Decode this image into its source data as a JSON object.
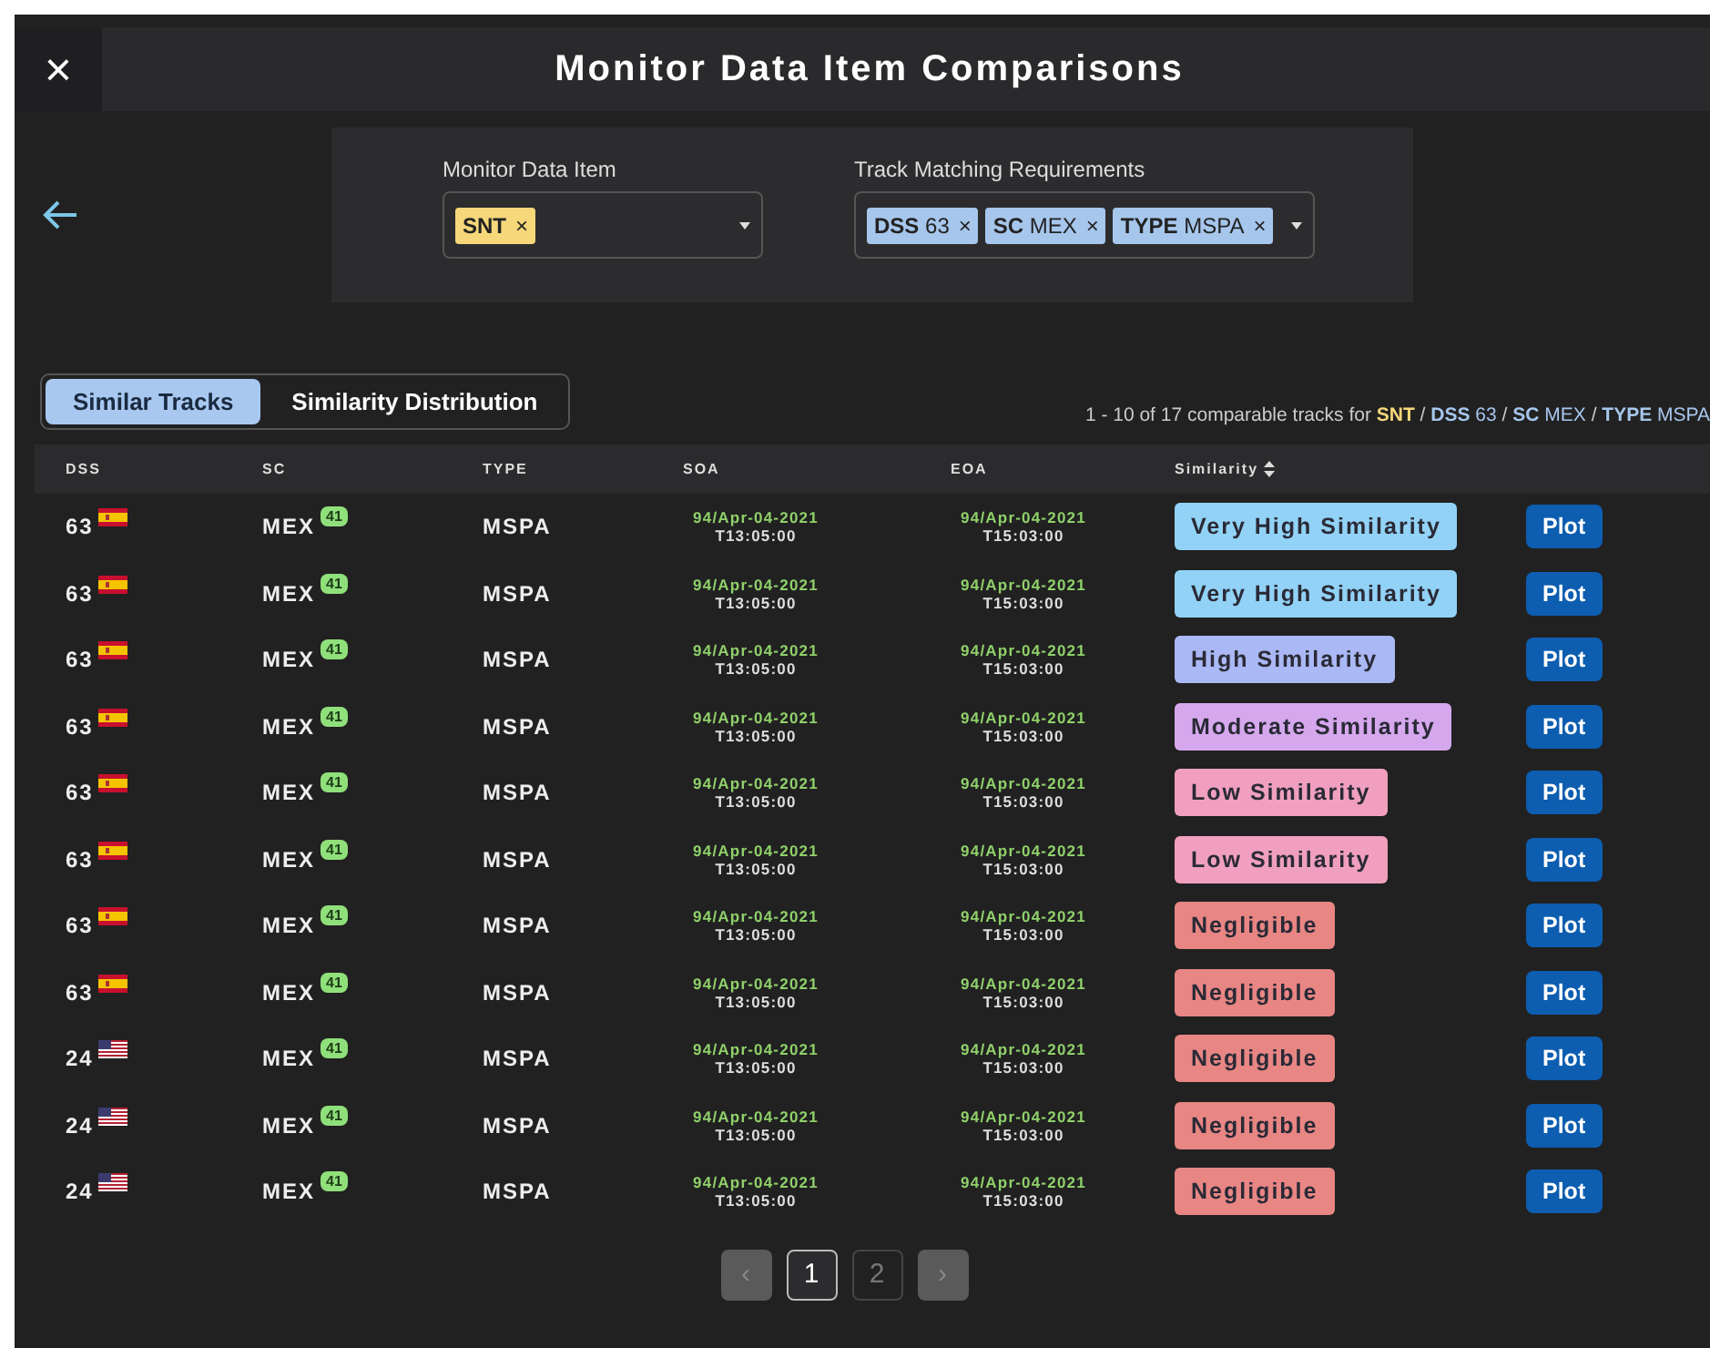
{
  "header": {
    "close": "×",
    "title": "Monitor Data Item Comparisons"
  },
  "filters": [
    {
      "label": "Monitor Data Item",
      "kind": "item",
      "chips": [
        {
          "key": "SNT",
          "remove": "×"
        }
      ]
    },
    {
      "label": "Track Matching Requirements",
      "kind": "requirement",
      "chips": [
        {
          "key": "DSS",
          "value": "63",
          "remove": "×"
        },
        {
          "key": "SC",
          "value": "MEX",
          "remove": "×"
        },
        {
          "key": "TYPE",
          "value": "MSPA",
          "remove": "×"
        }
      ]
    }
  ],
  "tabs": [
    {
      "label": "Similar Tracks",
      "selected": true
    },
    {
      "label": "Similarity Distribution",
      "selected": false
    }
  ],
  "summary": {
    "text": "1 - 10 of 17 comparable tracks for",
    "item": "SNT",
    "requirements": [
      {
        "key": "DSS",
        "value": "63"
      },
      {
        "key": "SC",
        "value": "MEX"
      },
      {
        "key": "TYPE",
        "value": "MSPA"
      }
    ],
    "separator": "/"
  },
  "table": {
    "columns": [
      "DSS",
      "SC",
      "TYPE",
      "SOA",
      "EOA",
      "Similarity"
    ],
    "rows": [
      {
        "dss": "63",
        "flag": {
          "kind": "es"
        },
        "sc": "MEX",
        "sc_badge": "41",
        "type": "MSPA",
        "soa": [
          "94/Apr-04-2021",
          "T13:05:00"
        ],
        "eoa": [
          "94/Apr-04-2021",
          "T15:03:00"
        ],
        "similarity": {
          "label": "Very High Similarity",
          "kind": "very_high"
        },
        "action": "Plot"
      },
      {
        "dss": "63",
        "flag": {
          "kind": "es"
        },
        "sc": "MEX",
        "sc_badge": "41",
        "type": "MSPA",
        "soa": [
          "94/Apr-04-2021",
          "T13:05:00"
        ],
        "eoa": [
          "94/Apr-04-2021",
          "T15:03:00"
        ],
        "similarity": {
          "label": "Very High Similarity",
          "kind": "very_high"
        },
        "action": "Plot"
      },
      {
        "dss": "63",
        "flag": {
          "kind": "es"
        },
        "sc": "MEX",
        "sc_badge": "41",
        "type": "MSPA",
        "soa": [
          "94/Apr-04-2021",
          "T13:05:00"
        ],
        "eoa": [
          "94/Apr-04-2021",
          "T15:03:00"
        ],
        "similarity": {
          "label": "High Similarity",
          "kind": "high"
        },
        "action": "Plot"
      },
      {
        "dss": "63",
        "flag": {
          "kind": "es"
        },
        "sc": "MEX",
        "sc_badge": "41",
        "type": "MSPA",
        "soa": [
          "94/Apr-04-2021",
          "T13:05:00"
        ],
        "eoa": [
          "94/Apr-04-2021",
          "T15:03:00"
        ],
        "similarity": {
          "label": "Moderate Similarity",
          "kind": "moderate"
        },
        "action": "Plot"
      },
      {
        "dss": "63",
        "flag": {
          "kind": "es"
        },
        "sc": "MEX",
        "sc_badge": "41",
        "type": "MSPA",
        "soa": [
          "94/Apr-04-2021",
          "T13:05:00"
        ],
        "eoa": [
          "94/Apr-04-2021",
          "T15:03:00"
        ],
        "similarity": {
          "label": "Low Similarity",
          "kind": "low"
        },
        "action": "Plot"
      },
      {
        "dss": "63",
        "flag": {
          "kind": "es"
        },
        "sc": "MEX",
        "sc_badge": "41",
        "type": "MSPA",
        "soa": [
          "94/Apr-04-2021",
          "T13:05:00"
        ],
        "eoa": [
          "94/Apr-04-2021",
          "T15:03:00"
        ],
        "similarity": {
          "label": "Low Similarity",
          "kind": "low"
        },
        "action": "Plot"
      },
      {
        "dss": "63",
        "flag": {
          "kind": "es"
        },
        "sc": "MEX",
        "sc_badge": "41",
        "type": "MSPA",
        "soa": [
          "94/Apr-04-2021",
          "T13:05:00"
        ],
        "eoa": [
          "94/Apr-04-2021",
          "T15:03:00"
        ],
        "similarity": {
          "label": "Negligible",
          "kind": "negligible"
        },
        "action": "Plot"
      },
      {
        "dss": "63",
        "flag": {
          "kind": "es"
        },
        "sc": "MEX",
        "sc_badge": "41",
        "type": "MSPA",
        "soa": [
          "94/Apr-04-2021",
          "T13:05:00"
        ],
        "eoa": [
          "94/Apr-04-2021",
          "T15:03:00"
        ],
        "similarity": {
          "label": "Negligible",
          "kind": "negligible"
        },
        "action": "Plot"
      },
      {
        "dss": "24",
        "flag": {
          "kind": "us"
        },
        "sc": "MEX",
        "sc_badge": "41",
        "type": "MSPA",
        "soa": [
          "94/Apr-04-2021",
          "T13:05:00"
        ],
        "eoa": [
          "94/Apr-04-2021",
          "T15:03:00"
        ],
        "similarity": {
          "label": "Negligible",
          "kind": "negligible"
        },
        "action": "Plot"
      },
      {
        "dss": "24",
        "flag": {
          "kind": "us"
        },
        "sc": "MEX",
        "sc_badge": "41",
        "type": "MSPA",
        "soa": [
          "94/Apr-04-2021",
          "T13:05:00"
        ],
        "eoa": [
          "94/Apr-04-2021",
          "T15:03:00"
        ],
        "similarity": {
          "label": "Negligible",
          "kind": "negligible"
        },
        "action": "Plot"
      },
      {
        "dss": "24",
        "flag": {
          "kind": "us"
        },
        "sc": "MEX",
        "sc_badge": "41",
        "type": "MSPA",
        "soa": [
          "94/Apr-04-2021",
          "T13:05:00"
        ],
        "eoa": [
          "94/Apr-04-2021",
          "T15:03:00"
        ],
        "similarity": {
          "label": "Negligible",
          "kind": "negligible"
        },
        "action": "Plot"
      }
    ]
  },
  "pagination": {
    "pages": [
      {
        "label": "1",
        "selected": true
      },
      {
        "label": "2",
        "selected": false
      }
    ],
    "prev": "‹",
    "next": "›"
  }
}
